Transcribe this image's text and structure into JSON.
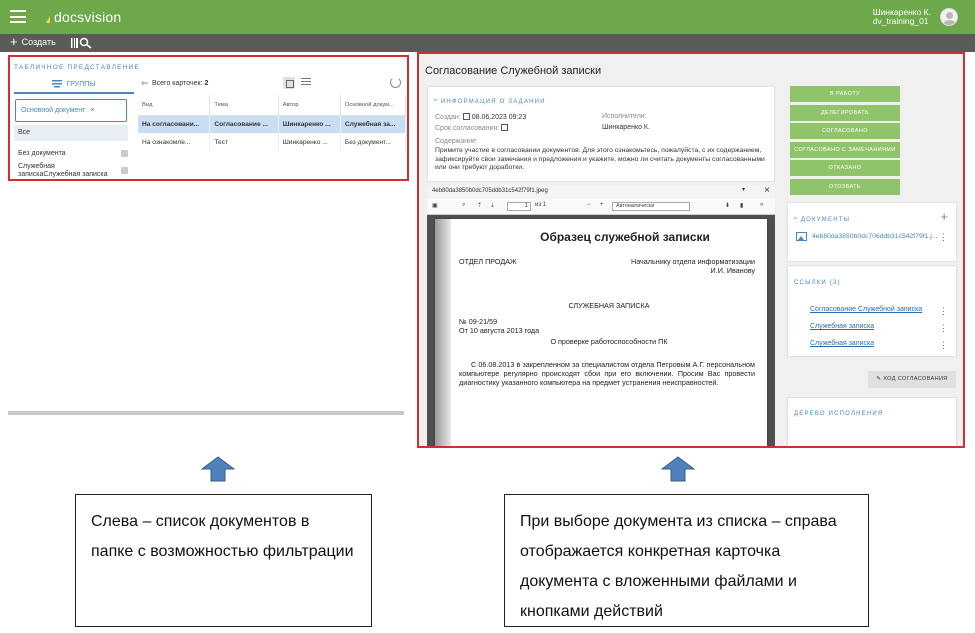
{
  "app": {
    "logo_text": "docsvision",
    "user_name": "Шинкаренко К.",
    "user_login": "dv_training_01",
    "brand_color": "#6da84a",
    "accent_color": "#4a87c5",
    "highlight_color": "#d32f2f"
  },
  "toolbar": {
    "create_label": "Создать",
    "create_icon": "plus-icon",
    "search_icon": "barcode-search-icon"
  },
  "left": {
    "table_view_label": "ТАБЛИЧНОЕ ПРЕДСТАВЛЕНИЕ",
    "groups_tab": "ГРУППЫ",
    "filter_chip": "Основной документ",
    "filter_chip_close": "×",
    "groups": [
      {
        "label": "Все"
      },
      {
        "label": "Без документа"
      },
      {
        "label": "Служебная запискаСлужебная записка"
      }
    ],
    "total_cards_label": "Всего карточек:",
    "total_cards_count": "2",
    "columns": [
      "Вид",
      "Тема",
      "Автор",
      "Основной докум..."
    ],
    "rows": [
      [
        "На согласовани...",
        "Согласование ...",
        "Шинкаренко ...",
        "Служебная за..."
      ],
      [
        "На ознакомле...",
        "Тест",
        "Шинкаренко ...",
        "Без документ..."
      ]
    ]
  },
  "card": {
    "title": "Согласование Служебной записки",
    "task_info_label": "ИНФОРМАЦИЯ О ЗАДАНИИ",
    "created_label": "Создан:",
    "created_value": "08.06.2023 09:23",
    "deadline_label": "Срок согласования:",
    "performers_label": "Исполнители:",
    "performers_value": "Шинкаренко К.",
    "content_label": "Содержание:",
    "content_text": "Примите участие в согласовании документов. Для этого ознакомьтесь, пожалуйста, с их содержанием, зафиксируйте свои замечания и предложения и укажите, можно ли считать документы согласованными или они требуют доработки.",
    "actions": [
      "В РАБОТУ",
      "ДЕЛЕГИРОВАТЬ",
      "СОГЛАСОВАНО",
      "СОГЛАСОВАНО С ЗАМЕЧАНИЯМИ",
      "ОТКАЗАНО",
      "ОТОЗВАТЬ"
    ],
    "documents_label": "ДОКУМЕНТЫ",
    "document_file": "4eb80da3850b0dc706ddb31c542f79f1.j...",
    "links_label": "ССЫЛКИ (3)",
    "links": [
      "Согласование Служебной записка",
      "Служебная записка",
      "Служебная записка"
    ],
    "route_button": "ХОД СОГЛАСОВАНИЯ",
    "tree_label": "ДЕРЕВО ИСПОЛНЕНИЯ"
  },
  "viewer": {
    "file_name": "4eb80da3850b0dc705ddb31c542f79f1.jpeg",
    "page_value": "1",
    "page_of": "из 1",
    "zoom_value": "Автоматически",
    "doc_title": "Образец служебной записки",
    "dept": "ОТДЕЛ ПРОДАЖ",
    "recipient_line1": "Начальнику отдела информатизации",
    "recipient_line2": "И.И. Иванову",
    "memo_heading": "СЛУЖЕБНАЯ ЗАПИСКА",
    "memo_number": "№ 09-21/59",
    "memo_date": "От 10 августа 2013 года",
    "memo_subject": "О проверке работоспособности ПК",
    "memo_body": "С 06.08.2013 в закрепленном за специалистом отдела Петровым А.Г. персональном компьютере регулярно происходят сбои при его включении. Просим Вас провести диагностику указанного компьютера на предмет устранения неисправностей."
  },
  "callouts": {
    "left": "Слева – список документов в папке с возможностью фильтрации",
    "right": "При выборе документа из списка – справа отображается конкретная карточка документа с вложенными файлами и кнопками действий"
  }
}
